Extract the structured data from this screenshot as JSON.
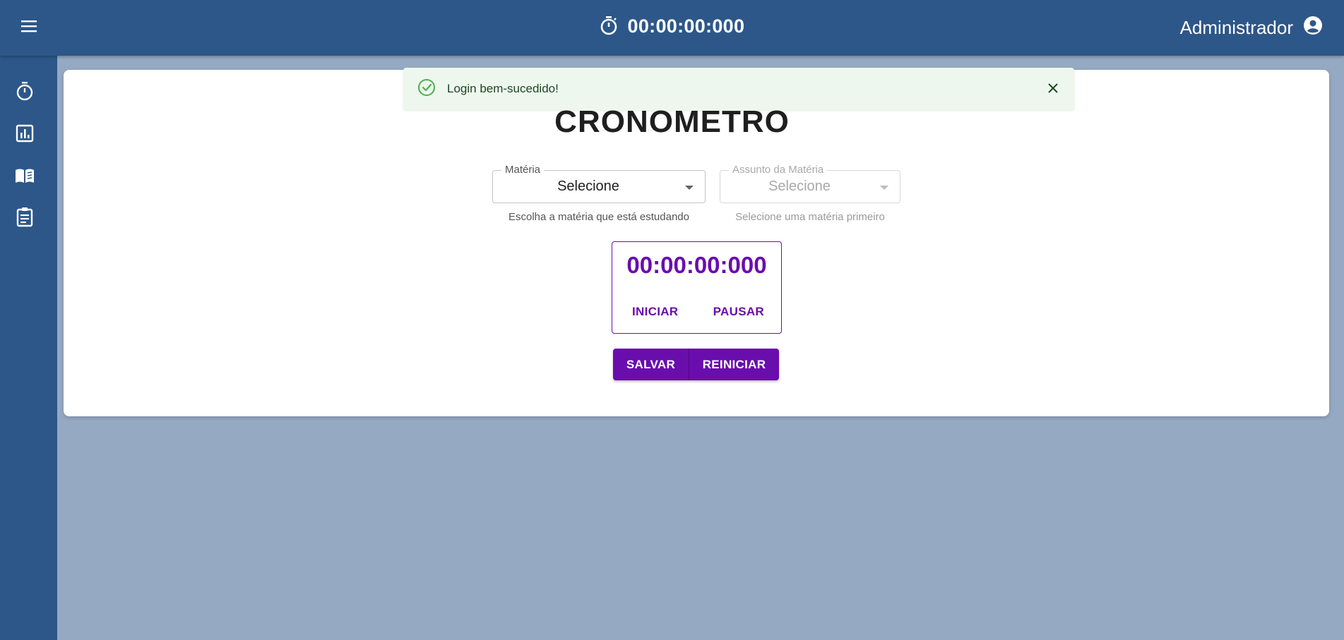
{
  "header": {
    "timer": "00:00:00:000",
    "user_name": "Administrador"
  },
  "sidebar": {
    "items": [
      {
        "icon": "stopwatch-icon"
      },
      {
        "icon": "chart-icon"
      },
      {
        "icon": "book-icon"
      },
      {
        "icon": "clipboard-icon"
      }
    ]
  },
  "toast": {
    "message": "Login bem-sucedido!"
  },
  "main": {
    "title": "CRONÔMETRO",
    "subject_select": {
      "label": "Matéria",
      "value": "Selecione",
      "helper": "Escolha a matéria que está estudando"
    },
    "topic_select": {
      "label": "Assunto da Matéria",
      "value": "Selecione",
      "helper": "Selecione uma matéria primeiro"
    },
    "timer": {
      "display": "00:00:00:000",
      "start_label": "INICIAR",
      "pause_label": "PAUSAR"
    },
    "actions": {
      "save_label": "SALVAR",
      "reset_label": "REINICIAR"
    }
  },
  "colors": {
    "primary_blue": "#2d5789",
    "background": "#96a9c3",
    "accent_purple": "#6a0dad",
    "toast_bg": "#eef7ee"
  }
}
